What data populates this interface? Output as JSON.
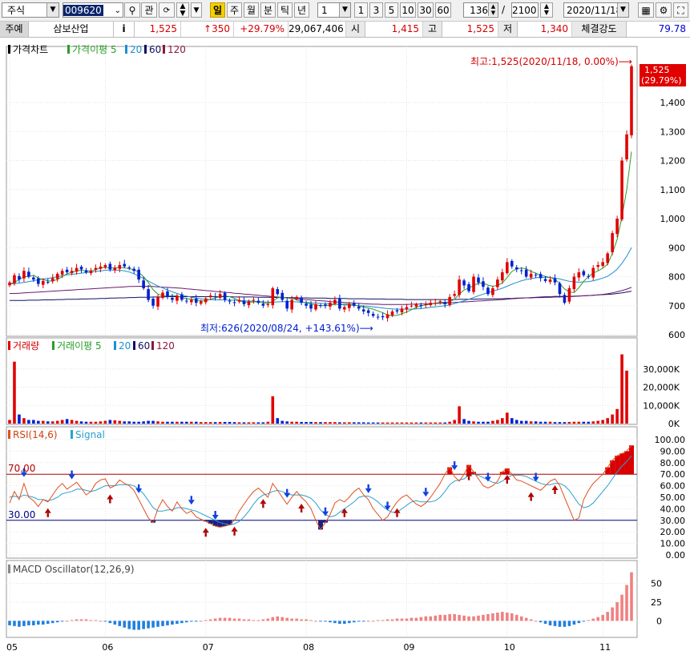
{
  "toolbar": {
    "market_select": "주식",
    "code": "009620",
    "search_icon": "search-icon",
    "btn_gwan": "관",
    "period_buttons": [
      "일",
      "주",
      "월",
      "분",
      "틱",
      "년"
    ],
    "active_period": "일",
    "interval_select": "1",
    "quick_counts": [
      "1",
      "3",
      "5",
      "10",
      "30",
      "60"
    ],
    "view_count": "136",
    "separator": "/",
    "total_count": "2100",
    "date": "2020/11/18"
  },
  "infobar": {
    "type_label": "주예",
    "stock_name": "삼보산업",
    "info_icon": "i",
    "price": "1,525",
    "change": "↑350",
    "change_rate": "+29.79%",
    "volume": "29,067,406",
    "open_label": "시",
    "open": "1,415",
    "high_label": "고",
    "high": "1,525",
    "low_label": "저",
    "low": "1,340",
    "strength_label": "체결강도",
    "strength": "79.78"
  },
  "colors": {
    "up": "#e00000",
    "down": "#0020d0",
    "ma5": "#2a9d2a",
    "ma20": "#1e8fd0",
    "ma60": "#6a1a6a",
    "ma120": "#101060",
    "rsi": "#e05020",
    "signal": "#2aa0d0"
  },
  "chart_data": [
    {
      "type": "candlestick",
      "title": "가격차트",
      "legend": [
        "가격이평 5",
        "20",
        "60",
        "120"
      ],
      "ylim": [
        600,
        1560
      ],
      "yticks": [
        "600",
        "700",
        "800",
        "900",
        "1,000",
        "1,100",
        "1,200",
        "1,300",
        "1,400"
      ],
      "xlabels": [
        "05",
        "06",
        "07",
        "08",
        "09",
        "10",
        "11"
      ],
      "max_annotation": "최고:1,525(2020/11/18, 0.00%)⟶",
      "min_annotation": "최저:626(2020/08/24, +143.61%)⟶",
      "last_price_label": "1,525",
      "last_rate_label": "(29.79%)",
      "closes": [
        780,
        805,
        790,
        820,
        800,
        790,
        775,
        785,
        780,
        795,
        810,
        820,
        815,
        820,
        830,
        825,
        815,
        820,
        830,
        835,
        840,
        825,
        830,
        840,
        835,
        830,
        820,
        790,
        760,
        720,
        700,
        730,
        745,
        730,
        720,
        735,
        720,
        715,
        720,
        710,
        715,
        725,
        735,
        730,
        740,
        720,
        715,
        710,
        720,
        705,
        715,
        720,
        710,
        700,
        705,
        760,
        740,
        720,
        690,
        720,
        730,
        710,
        700,
        690,
        705,
        700,
        700,
        710,
        720,
        690,
        695,
        705,
        700,
        690,
        680,
        675,
        665,
        660,
        660,
        670,
        680,
        680,
        690,
        695,
        700,
        705,
        700,
        705,
        710,
        710,
        715,
        705,
        730,
        740,
        790,
        770,
        750,
        800,
        780,
        765,
        740,
        760,
        790,
        815,
        850,
        835,
        825,
        820,
        800,
        810,
        805,
        795,
        785,
        790,
        780,
        740,
        710,
        760,
        800,
        815,
        805,
        800,
        830,
        840,
        850,
        880,
        950,
        1000,
        1200,
        1290,
        1525
      ],
      "ma5": [
        775,
        780,
        790,
        800,
        800,
        805,
        795,
        790,
        785,
        785,
        790,
        800,
        810,
        815,
        820,
        822,
        820,
        820,
        824,
        830,
        832,
        830,
        830,
        832,
        830,
        828,
        824,
        815,
        800,
        780,
        755,
        740,
        735,
        732,
        735,
        733,
        728,
        724,
        722,
        720,
        716,
        717,
        722,
        727,
        732,
        733,
        731,
        725,
        717,
        712,
        712,
        713,
        713,
        711,
        707,
        715,
        727,
        730,
        727,
        726,
        720,
        714,
        710,
        706,
        703,
        700,
        700,
        701,
        705,
        705,
        705,
        706,
        702,
        699,
        695,
        692,
        688,
        682,
        676,
        668,
        665,
        667,
        672,
        678,
        686,
        694,
        699,
        703,
        705,
        708,
        712,
        711,
        714,
        722,
        740,
        754,
        761,
        769,
        778,
        777,
        771,
        767,
        770,
        778,
        797,
        818,
        827,
        830,
        827,
        818,
        812,
        805,
        801,
        797,
        791,
        776,
        758,
        747,
        745,
        762,
        784,
        800,
        812,
        820,
        829,
        843,
        880,
        928,
        1007,
        1099,
        1231
      ],
      "ma20": [
        775,
        776,
        778,
        780,
        783,
        786,
        789,
        792,
        794,
        797,
        800,
        803,
        806,
        808,
        810,
        812,
        814,
        816,
        818,
        820,
        822,
        823,
        823,
        822,
        820,
        816,
        810,
        802,
        794,
        785,
        776,
        768,
        761,
        754,
        748,
        742,
        737,
        733,
        729,
        726,
        724,
        722,
        721,
        720,
        720,
        720,
        719,
        719,
        718,
        717,
        716,
        715,
        714,
        713,
        712,
        712,
        713,
        714,
        714,
        714,
        713,
        712,
        711,
        710,
        709,
        708,
        707,
        706,
        705,
        704,
        703,
        702,
        701,
        700,
        699,
        698,
        696,
        694,
        692,
        690,
        689,
        688,
        688,
        688,
        688,
        689,
        690,
        692,
        694,
        696,
        698,
        700,
        703,
        707,
        712,
        717,
        722,
        728,
        734,
        740,
        745,
        750,
        755,
        760,
        767,
        774,
        780,
        786,
        790,
        793,
        796,
        797,
        798,
        797,
        795,
        792,
        788,
        784,
        782,
        781,
        782,
        783,
        786,
        790,
        795,
        801,
        812,
        826,
        846,
        870,
        900
      ],
      "ma60": [
        742,
        742,
        743,
        744,
        745,
        746,
        747,
        748,
        749,
        750,
        751,
        752,
        753,
        754,
        755,
        756,
        757,
        758,
        759,
        760,
        761,
        762,
        763,
        764,
        765,
        766,
        766,
        767,
        767,
        767,
        766,
        765,
        764,
        763,
        762,
        761,
        760,
        758,
        757,
        755,
        754,
        752,
        751,
        749,
        748,
        746,
        745,
        743,
        742,
        740,
        739,
        737,
        736,
        734,
        733,
        731,
        730,
        728,
        727,
        725,
        724,
        722,
        721,
        720,
        718,
        717,
        716,
        714,
        713,
        712,
        711,
        710,
        709,
        708,
        707,
        706,
        705,
        705,
        704,
        704,
        704,
        704,
        704,
        704,
        705,
        705,
        706,
        706,
        707,
        708,
        708,
        709,
        710,
        711,
        712,
        713,
        714,
        715,
        716,
        717,
        718,
        719,
        720,
        721,
        722,
        724,
        725,
        726,
        727,
        728,
        729,
        730,
        731,
        731,
        732,
        732,
        732,
        732,
        733,
        733,
        734,
        735,
        736,
        737,
        739,
        741,
        744,
        748,
        752,
        757,
        763
      ],
      "ma120": [
        718,
        718,
        718,
        718,
        719,
        719,
        719,
        720,
        720,
        720,
        721,
        721,
        722,
        722,
        722,
        723,
        723,
        724,
        724,
        725,
        725,
        726,
        726,
        727,
        727,
        728,
        728,
        729,
        729,
        729,
        730,
        730,
        730,
        731,
        731,
        731,
        731,
        731,
        731,
        731,
        731,
        731,
        731,
        731,
        731,
        731,
        731,
        730,
        730,
        730,
        730,
        730,
        729,
        729,
        729,
        729,
        728,
        728,
        728,
        728,
        727,
        727,
        727,
        726,
        726,
        726,
        726,
        725,
        725,
        725,
        725,
        724,
        724,
        724,
        724,
        723,
        723,
        723,
        723,
        722,
        722,
        722,
        722,
        721,
        721,
        721,
        721,
        721,
        721,
        721,
        721,
        721,
        721,
        721,
        722,
        722,
        722,
        722,
        723,
        723,
        723,
        724,
        724,
        724,
        725,
        725,
        726,
        726,
        727,
        727,
        728,
        728,
        729,
        729,
        730,
        730,
        731,
        731,
        732,
        733,
        734,
        735,
        736,
        737,
        738,
        739,
        740,
        742,
        744,
        747,
        750
      ]
    },
    {
      "type": "bar",
      "title": "거래량",
      "legend": [
        "거래이평 5",
        "20",
        "60",
        "120"
      ],
      "ylim": [
        0,
        40000
      ],
      "yticks": [
        "0K",
        "10,000K",
        "20,000K",
        "30,000K"
      ],
      "values_k": [
        2000,
        34000,
        5000,
        3000,
        2000,
        2000,
        1500,
        1500,
        1200,
        1200,
        1500,
        2000,
        2500,
        2000,
        1500,
        1200,
        1000,
        1000,
        1000,
        1200,
        1500,
        2000,
        1800,
        1500,
        1200,
        1200,
        1000,
        1000,
        1200,
        1500,
        1500,
        1200,
        1000,
        1000,
        1000,
        1000,
        1000,
        1000,
        1000,
        1000,
        800,
        800,
        800,
        800,
        900,
        900,
        900,
        800,
        700,
        700,
        700,
        700,
        700,
        700,
        1000,
        15000,
        3000,
        1500,
        1200,
        1000,
        1000,
        900,
        900,
        900,
        800,
        800,
        800,
        800,
        800,
        700,
        700,
        700,
        700,
        700,
        700,
        600,
        600,
        600,
        600,
        600,
        600,
        600,
        600,
        600,
        600,
        600,
        600,
        600,
        600,
        600,
        600,
        600,
        1000,
        2000,
        9500,
        2500,
        1500,
        1200,
        1000,
        1000,
        1000,
        1500,
        2000,
        3000,
        6000,
        3000,
        2000,
        1500,
        1500,
        1200,
        1200,
        1000,
        1000,
        1000,
        800,
        800,
        800,
        900,
        1000,
        1000,
        1000,
        1000,
        1200,
        1500,
        2000,
        3000,
        5000,
        8000,
        38000,
        29067
      ]
    },
    {
      "type": "line",
      "title": "RSI(14,6)",
      "legend": [
        "Signal"
      ],
      "ylim": [
        0,
        100
      ],
      "yticks": [
        "0.00",
        "10.00",
        "20.00",
        "30.00",
        "40.00",
        "50.00",
        "60.00",
        "70.00",
        "80.00",
        "90.00",
        "100.00"
      ],
      "reference_lines": [
        70,
        30
      ],
      "reference_labels": [
        "70.00",
        "30.00"
      ],
      "rsi": [
        45,
        55,
        48,
        62,
        50,
        47,
        42,
        48,
        46,
        52,
        58,
        62,
        57,
        60,
        63,
        58,
        52,
        55,
        62,
        65,
        66,
        58,
        60,
        65,
        62,
        60,
        56,
        48,
        40,
        32,
        28,
        40,
        48,
        42,
        38,
        46,
        40,
        36,
        38,
        33,
        31,
        29,
        27,
        25,
        24,
        25,
        26,
        30,
        38,
        44,
        50,
        55,
        58,
        54,
        50,
        62,
        56,
        50,
        44,
        50,
        55,
        50,
        46,
        40,
        30,
        22,
        28,
        35,
        45,
        48,
        46,
        50,
        55,
        58,
        52,
        48,
        40,
        35,
        30,
        33,
        40,
        46,
        50,
        52,
        48,
        44,
        42,
        45,
        50,
        56,
        62,
        70,
        76,
        68,
        64,
        70,
        78,
        72,
        66,
        60,
        58,
        60,
        64,
        72,
        75,
        70,
        65,
        64,
        62,
        60,
        58,
        56,
        60,
        64,
        66,
        60,
        50,
        40,
        30,
        32,
        48,
        56,
        62,
        66,
        70,
        76,
        82,
        86,
        88,
        90,
        95
      ],
      "signal": [
        50,
        51,
        50,
        52,
        51,
        50,
        48,
        48,
        47,
        48,
        50,
        53,
        54,
        55,
        57,
        57,
        56,
        55,
        56,
        58,
        60,
        60,
        60,
        61,
        61,
        61,
        60,
        57,
        53,
        47,
        41,
        38,
        38,
        39,
        39,
        41,
        41,
        40,
        39,
        38,
        36,
        34,
        32,
        30,
        28,
        27,
        26,
        27,
        29,
        33,
        38,
        44,
        49,
        52,
        53,
        55,
        56,
        55,
        53,
        52,
        52,
        52,
        51,
        49,
        45,
        39,
        35,
        33,
        34,
        37,
        40,
        43,
        46,
        50,
        51,
        51,
        49,
        46,
        42,
        39,
        37,
        37,
        40,
        43,
        46,
        47,
        46,
        46,
        46,
        47,
        50,
        55,
        61,
        64,
        65,
        66,
        69,
        70,
        69,
        67,
        65,
        63,
        62,
        64,
        67,
        69,
        69,
        69,
        68,
        66,
        64,
        62,
        61,
        61,
        62,
        62,
        60,
        56,
        50,
        44,
        41,
        42,
        45,
        50,
        55,
        60,
        66,
        72,
        77,
        81,
        86
      ],
      "up_markers": [
        8,
        21,
        41,
        47,
        53,
        61,
        70,
        81,
        96,
        104,
        109,
        114
      ],
      "down_markers": [
        3,
        13,
        27,
        38,
        43,
        58,
        66,
        75,
        79,
        87,
        93,
        100,
        110
      ]
    },
    {
      "type": "bar",
      "title": "MACD Oscillator(12,26,9)",
      "ylim": [
        -20,
        70
      ],
      "yticks": [
        "0",
        "25",
        "50"
      ],
      "values": [
        -6,
        -7,
        -8,
        -7,
        -6,
        -6,
        -5,
        -5,
        -4,
        -3,
        -2,
        -1,
        0,
        1,
        2,
        2,
        2,
        1,
        1,
        0,
        -1,
        -3,
        -5,
        -7,
        -9,
        -11,
        -12,
        -12,
        -11,
        -10,
        -9,
        -8,
        -7,
        -6,
        -5,
        -4,
        -3,
        -2,
        -1,
        -1,
        0,
        1,
        2,
        3,
        4,
        4,
        4,
        3,
        3,
        2,
        2,
        1,
        1,
        2,
        3,
        5,
        6,
        5,
        4,
        3,
        3,
        2,
        2,
        1,
        0,
        -1,
        -1,
        -2,
        -3,
        -4,
        -4,
        -3,
        -2,
        -1,
        -1,
        0,
        0,
        1,
        1,
        2,
        2,
        3,
        3,
        3,
        4,
        4,
        5,
        6,
        6,
        7,
        8,
        8,
        9,
        9,
        8,
        7,
        6,
        6,
        7,
        8,
        9,
        10,
        11,
        12,
        11,
        10,
        8,
        6,
        4,
        2,
        0,
        -2,
        -4,
        -6,
        -7,
        -8,
        -8,
        -7,
        -5,
        -3,
        -1,
        1,
        3,
        5,
        8,
        12,
        18,
        25,
        35,
        48,
        65
      ]
    }
  ]
}
